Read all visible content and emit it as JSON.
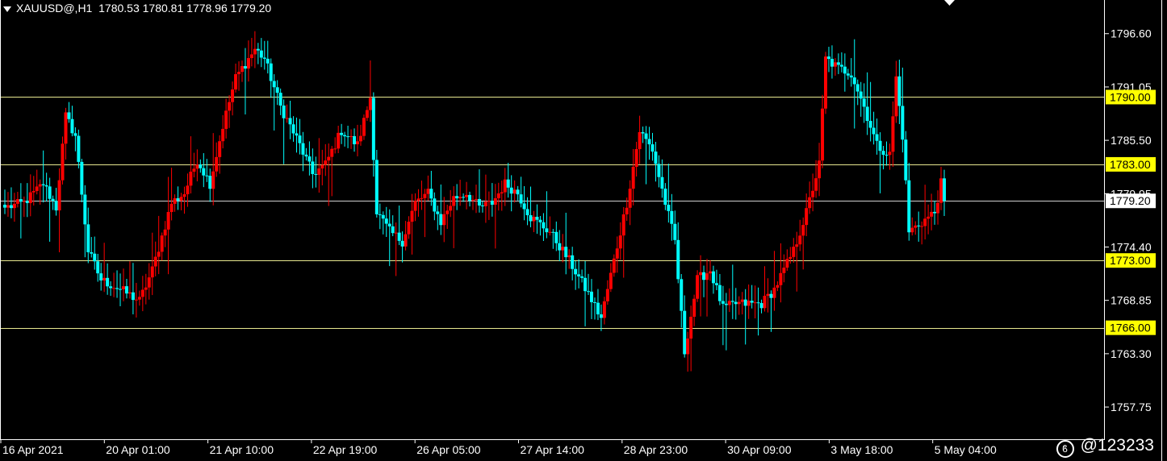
{
  "header": {
    "symbol": "XAUUSD@,H1",
    "ohlc": "1780.53 1780.81 1778.96 1779.20"
  },
  "watermark": {
    "text": "@123233"
  },
  "colors": {
    "bull": "#ff0000",
    "bear": "#00ffff",
    "level_line": "#e8e890",
    "level_label_bg": "#ffff00",
    "current_label_bg": "#ffffff",
    "axis": "#ffffff",
    "background": "#000000"
  },
  "chart_data": {
    "type": "candlestick",
    "symbol": "XAUUSD@",
    "timeframe": "H1",
    "price_ticks": [
      "1796.60",
      "1791.05",
      "1785.50",
      "1779.95",
      "1774.40",
      "1768.85",
      "1763.30",
      "1757.75"
    ],
    "time_labels": [
      "16 Apr 2021",
      "20 Apr 01:00",
      "21 Apr 10:00",
      "22 Apr 19:00",
      "26 Apr 05:00",
      "27 Apr 14:00",
      "28 Apr 23:00",
      "30 Apr 09:00",
      "3 May 18:00",
      "5 May 04:00"
    ],
    "ylim": [
      1754.4,
      1800.1
    ],
    "levels": [
      "1790.00",
      "1783.00",
      "1773.00",
      "1766.00"
    ],
    "current_price": "1779.20",
    "anchors": [
      {
        "i": 0,
        "p": 1778.5
      },
      {
        "i": 6,
        "p": 1779
      },
      {
        "i": 12,
        "p": 1781
      },
      {
        "i": 16,
        "p": 1778.5
      },
      {
        "i": 19,
        "p": 1788
      },
      {
        "i": 22,
        "p": 1786
      },
      {
        "i": 26,
        "p": 1774
      },
      {
        "i": 30,
        "p": 1771
      },
      {
        "i": 36,
        "p": 1770
      },
      {
        "i": 42,
        "p": 1768.8
      },
      {
        "i": 46,
        "p": 1772
      },
      {
        "i": 52,
        "p": 1779
      },
      {
        "i": 56,
        "p": 1780
      },
      {
        "i": 60,
        "p": 1783.5
      },
      {
        "i": 64,
        "p": 1781
      },
      {
        "i": 68,
        "p": 1787
      },
      {
        "i": 72,
        "p": 1792
      },
      {
        "i": 78,
        "p": 1795
      },
      {
        "i": 81,
        "p": 1794
      },
      {
        "i": 86,
        "p": 1789
      },
      {
        "i": 92,
        "p": 1785
      },
      {
        "i": 96,
        "p": 1782
      },
      {
        "i": 100,
        "p": 1783
      },
      {
        "i": 105,
        "p": 1786.5
      },
      {
        "i": 110,
        "p": 1785
      },
      {
        "i": 114,
        "p": 1790
      },
      {
        "i": 116,
        "p": 1778
      },
      {
        "i": 120,
        "p": 1776
      },
      {
        "i": 124,
        "p": 1775
      },
      {
        "i": 128,
        "p": 1779
      },
      {
        "i": 132,
        "p": 1780
      },
      {
        "i": 136,
        "p": 1777
      },
      {
        "i": 140,
        "p": 1779.5
      },
      {
        "i": 144,
        "p": 1780
      },
      {
        "i": 148,
        "p": 1778.5
      },
      {
        "i": 152,
        "p": 1779
      },
      {
        "i": 156,
        "p": 1781
      },
      {
        "i": 160,
        "p": 1780
      },
      {
        "i": 164,
        "p": 1777.5
      },
      {
        "i": 170,
        "p": 1776
      },
      {
        "i": 176,
        "p": 1773
      },
      {
        "i": 182,
        "p": 1769.5
      },
      {
        "i": 186,
        "p": 1767
      },
      {
        "i": 190,
        "p": 1773
      },
      {
        "i": 194,
        "p": 1779
      },
      {
        "i": 198,
        "p": 1786.5
      },
      {
        "i": 202,
        "p": 1784.5
      },
      {
        "i": 206,
        "p": 1779
      },
      {
        "i": 209,
        "p": 1775
      },
      {
        "i": 212,
        "p": 1763.5
      },
      {
        "i": 216,
        "p": 1771
      },
      {
        "i": 220,
        "p": 1772
      },
      {
        "i": 224,
        "p": 1768
      },
      {
        "i": 228,
        "p": 1768.5
      },
      {
        "i": 232,
        "p": 1768.5
      },
      {
        "i": 236,
        "p": 1768.5
      },
      {
        "i": 240,
        "p": 1770
      },
      {
        "i": 246,
        "p": 1774
      },
      {
        "i": 250,
        "p": 1778
      },
      {
        "i": 254,
        "p": 1783
      },
      {
        "i": 256,
        "p": 1794
      },
      {
        "i": 260,
        "p": 1793
      },
      {
        "i": 264,
        "p": 1792.5
      },
      {
        "i": 268,
        "p": 1789
      },
      {
        "i": 272,
        "p": 1785
      },
      {
        "i": 276,
        "p": 1784
      },
      {
        "i": 278,
        "p": 1792
      },
      {
        "i": 280,
        "p": 1786
      },
      {
        "i": 282,
        "p": 1776
      },
      {
        "i": 286,
        "p": 1777
      },
      {
        "i": 290,
        "p": 1778
      },
      {
        "i": 292,
        "p": 1781
      },
      {
        "i": 293,
        "p": 1779.2
      }
    ]
  }
}
